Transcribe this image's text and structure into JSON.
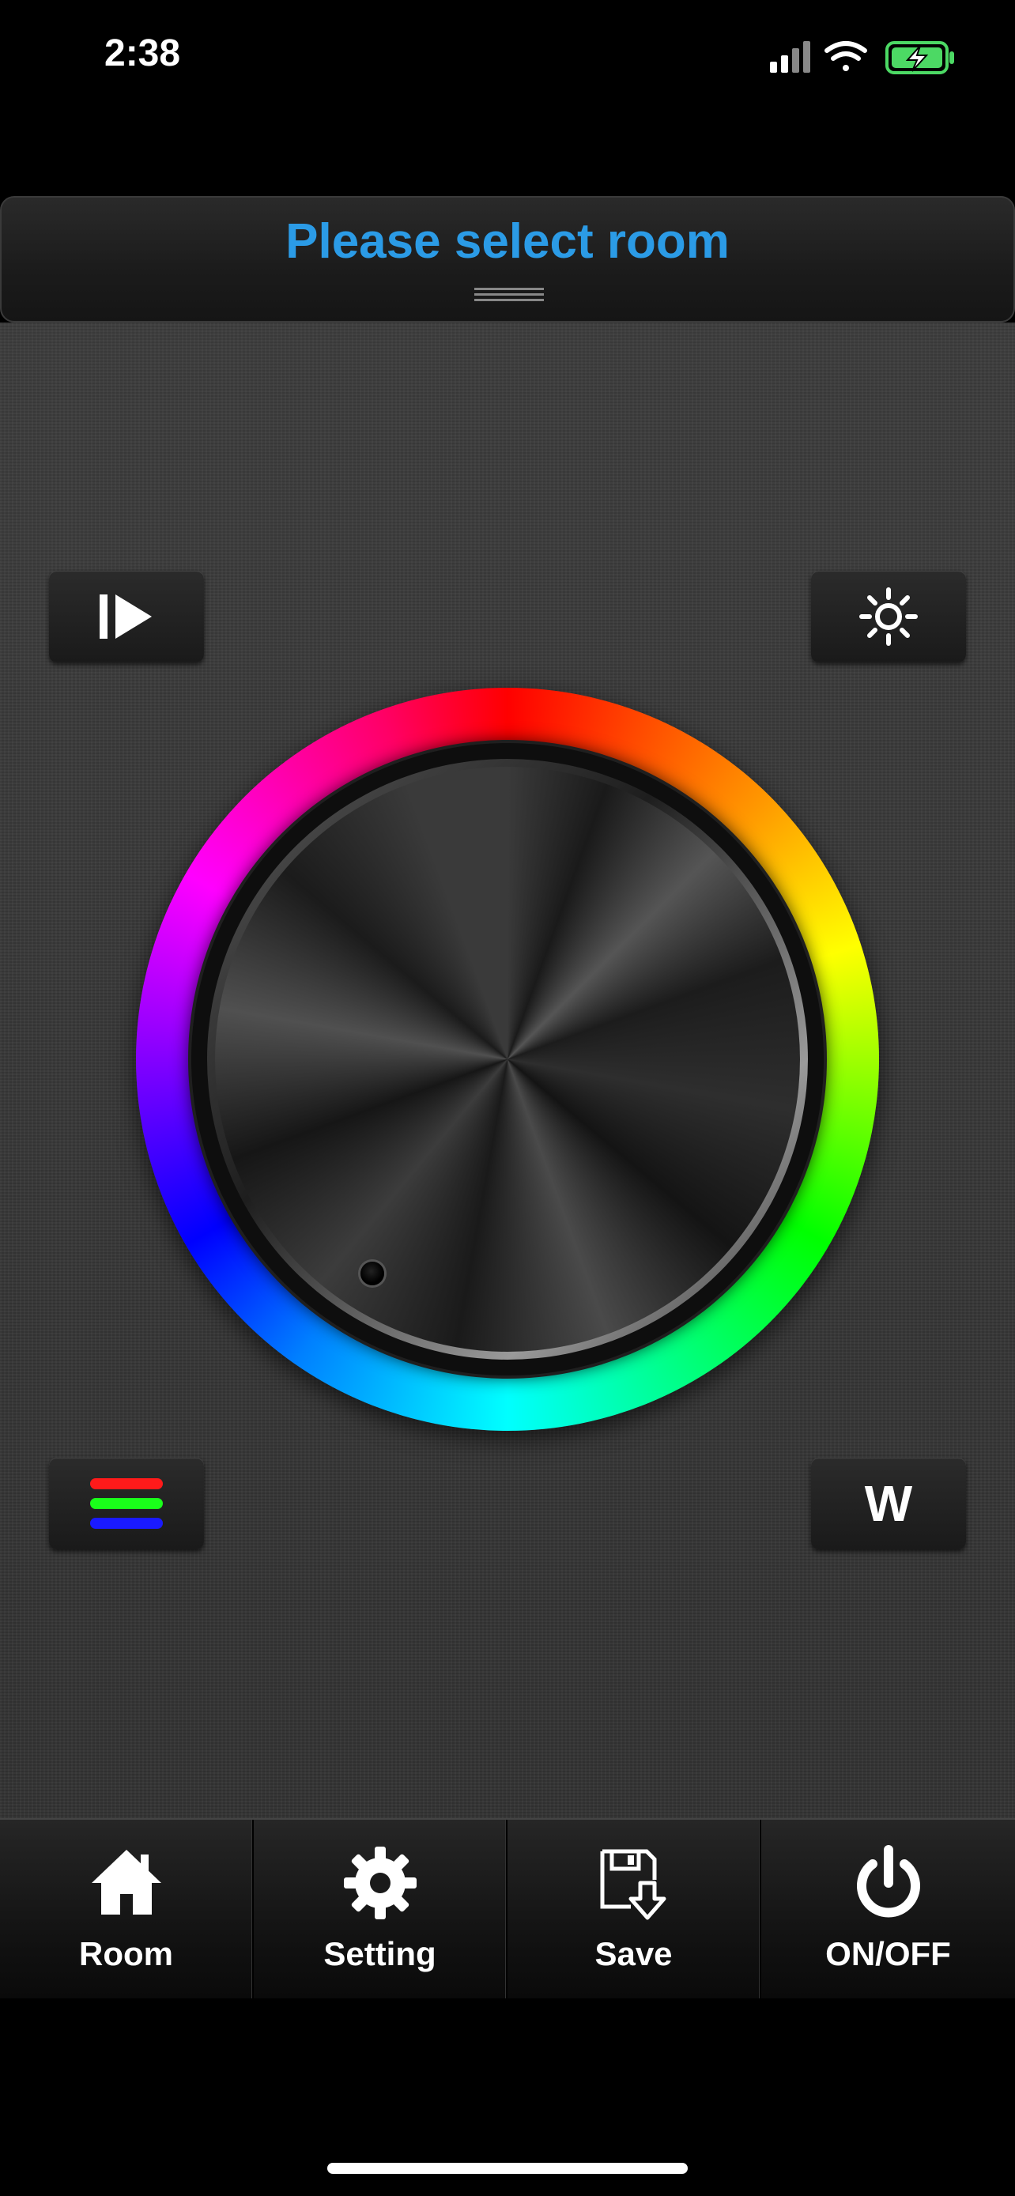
{
  "status_bar": {
    "time": "2:38",
    "signal_icon": "cellular-signal-icon",
    "wifi_icon": "wifi-icon",
    "battery_icon": "battery-charging-icon",
    "battery_color": "#4cd964"
  },
  "header": {
    "title": "Please select room",
    "title_color": "#2b9be6",
    "handle_icon": "drag-handle-icon"
  },
  "controls": {
    "play_icon": "play-mode-icon",
    "brightness_icon": "brightness-sun-icon",
    "rgb_icon": "rgb-bars-icon",
    "white_label": "W"
  },
  "wheel": {
    "icon": "color-wheel",
    "knob_icon": "rotary-knob"
  },
  "tabs": [
    {
      "label": "Room",
      "icon": "home-icon"
    },
    {
      "label": "Setting",
      "icon": "gear-icon"
    },
    {
      "label": "Save",
      "icon": "save-icon"
    },
    {
      "label": "ON/OFF",
      "icon": "power-icon"
    }
  ]
}
